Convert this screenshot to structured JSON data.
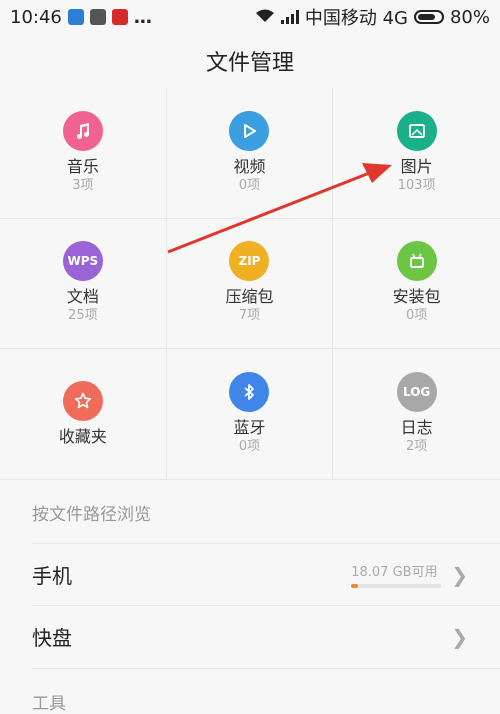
{
  "status_bar": {
    "time": "10:46",
    "dots": "…",
    "carrier": "中国移动 4G",
    "battery_percent": "80%",
    "battery_level": 0.8
  },
  "page": {
    "title": "文件管理"
  },
  "categories": [
    {
      "label": "音乐",
      "count": "3项",
      "icon": "music-note-icon",
      "color": "#f06292"
    },
    {
      "label": "视频",
      "count": "0项",
      "icon": "play-icon",
      "color": "#3a9ee0"
    },
    {
      "label": "图片",
      "count": "103项",
      "icon": "picture-icon",
      "color": "#19b08a"
    },
    {
      "label": "文档",
      "count": "25项",
      "icon": "wps-doc-icon",
      "color": "#9a63d6",
      "icon_text": "WPS"
    },
    {
      "label": "压缩包",
      "count": "7项",
      "icon": "zip-icon",
      "color": "#f0b024",
      "icon_text": "ZIP"
    },
    {
      "label": "安装包",
      "count": "0项",
      "icon": "android-icon",
      "color": "#6cc644"
    },
    {
      "label": "收藏夹",
      "count": "",
      "icon": "star-icon",
      "color": "#ef6b5a"
    },
    {
      "label": "蓝牙",
      "count": "0项",
      "icon": "bluetooth-icon",
      "color": "#3f86e8"
    },
    {
      "label": "日志",
      "count": "2项",
      "icon": "log-icon",
      "color": "#a8a8a8",
      "icon_text": "LOG"
    }
  ],
  "browse": {
    "section_title": "按文件路径浏览",
    "phone": {
      "label": "手机",
      "storage": "18.07 GB可用",
      "used_fraction": 0.08
    },
    "cloud": {
      "label": "快盘"
    }
  },
  "tools": {
    "title": "工具"
  },
  "annotation": {
    "color": "#e0362c"
  }
}
